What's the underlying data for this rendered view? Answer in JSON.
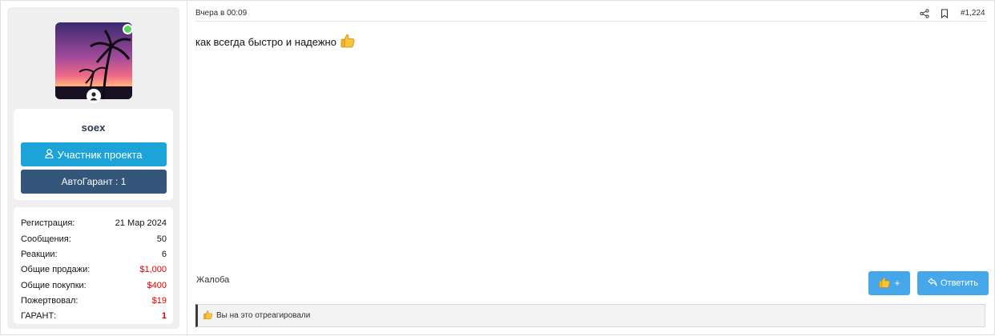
{
  "post": {
    "date": "Вчера в 00:09",
    "number": "#1,224",
    "message": "как всегда быстро и надежно",
    "report_label": "Жалоба",
    "like_label": "+",
    "reply_label": "Ответить",
    "reactions_text": "Вы на это отреагировали"
  },
  "user": {
    "name": "soex",
    "role_label": "Участник проекта",
    "garant_label": "АвтоГарант : 1",
    "online": true,
    "stats": [
      {
        "label": "Регистрация:",
        "value": "21 Мар 2024"
      },
      {
        "label": "Сообщения:",
        "value": "50"
      },
      {
        "label": "Реакции:",
        "value": "6"
      },
      {
        "label": "Общие продажи:",
        "value": "$1,000"
      },
      {
        "label": "Общие покупки:",
        "value": "$400"
      },
      {
        "label": "Пожертвовал:",
        "value": "$19"
      },
      {
        "label": "ГАРАНТ:",
        "value": "1"
      }
    ]
  },
  "colors": {
    "member_button": "#1ca4d9",
    "garant_button": "#34567a",
    "action_button": "#47a7eb",
    "money_red": "#e00000",
    "online_green": "#5fd35f"
  },
  "icons": [
    "share-icon",
    "bookmark-icon",
    "thumbs-up-icon",
    "user-icon",
    "reply-icon"
  ]
}
